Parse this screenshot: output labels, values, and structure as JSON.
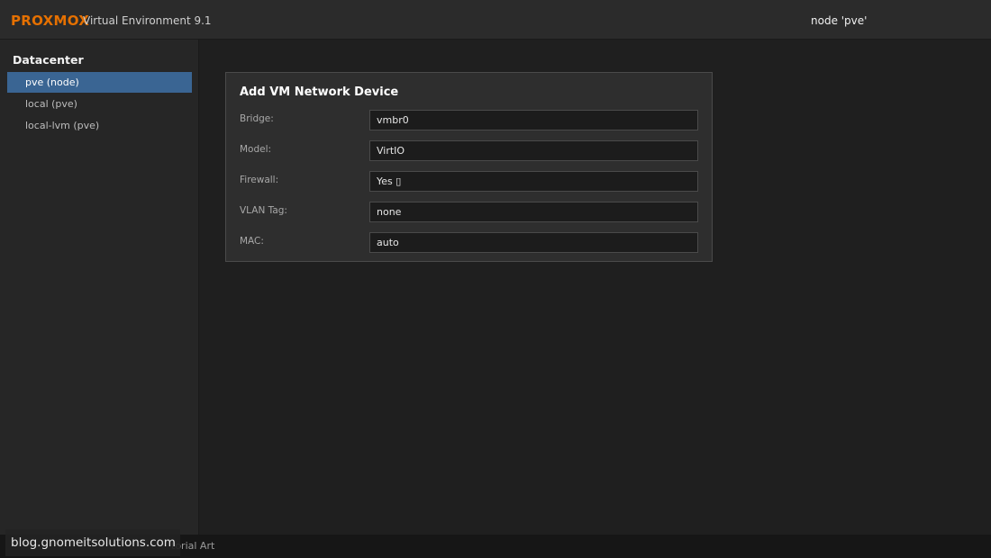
{
  "header": {
    "brand": "PROXMOX",
    "product": "Virtual Environment 9.1",
    "node": "node 'pve'"
  },
  "sidebar": {
    "title": "Datacenter",
    "items": [
      {
        "label": "pve (node)",
        "selected": true
      },
      {
        "label": "local (pve)",
        "selected": false
      },
      {
        "label": "local-lvm (pve)",
        "selected": false
      }
    ]
  },
  "dialog": {
    "title": "Add VM Network Device",
    "fields": [
      {
        "label": "Bridge:",
        "value": "vmbr0"
      },
      {
        "label": "Model:",
        "value": "VirtIO"
      },
      {
        "label": "Firewall:",
        "value": "Yes ▯"
      },
      {
        "label": "VLAN Tag:",
        "value": "none"
      },
      {
        "label": "MAC:",
        "value": "auto"
      }
    ]
  },
  "footer": {
    "text": "torial Art"
  },
  "watermark": {
    "text": "blog.gnomeitsolutions.com"
  },
  "colors": {
    "brand": "#e57000",
    "selected": "#3a6593"
  }
}
